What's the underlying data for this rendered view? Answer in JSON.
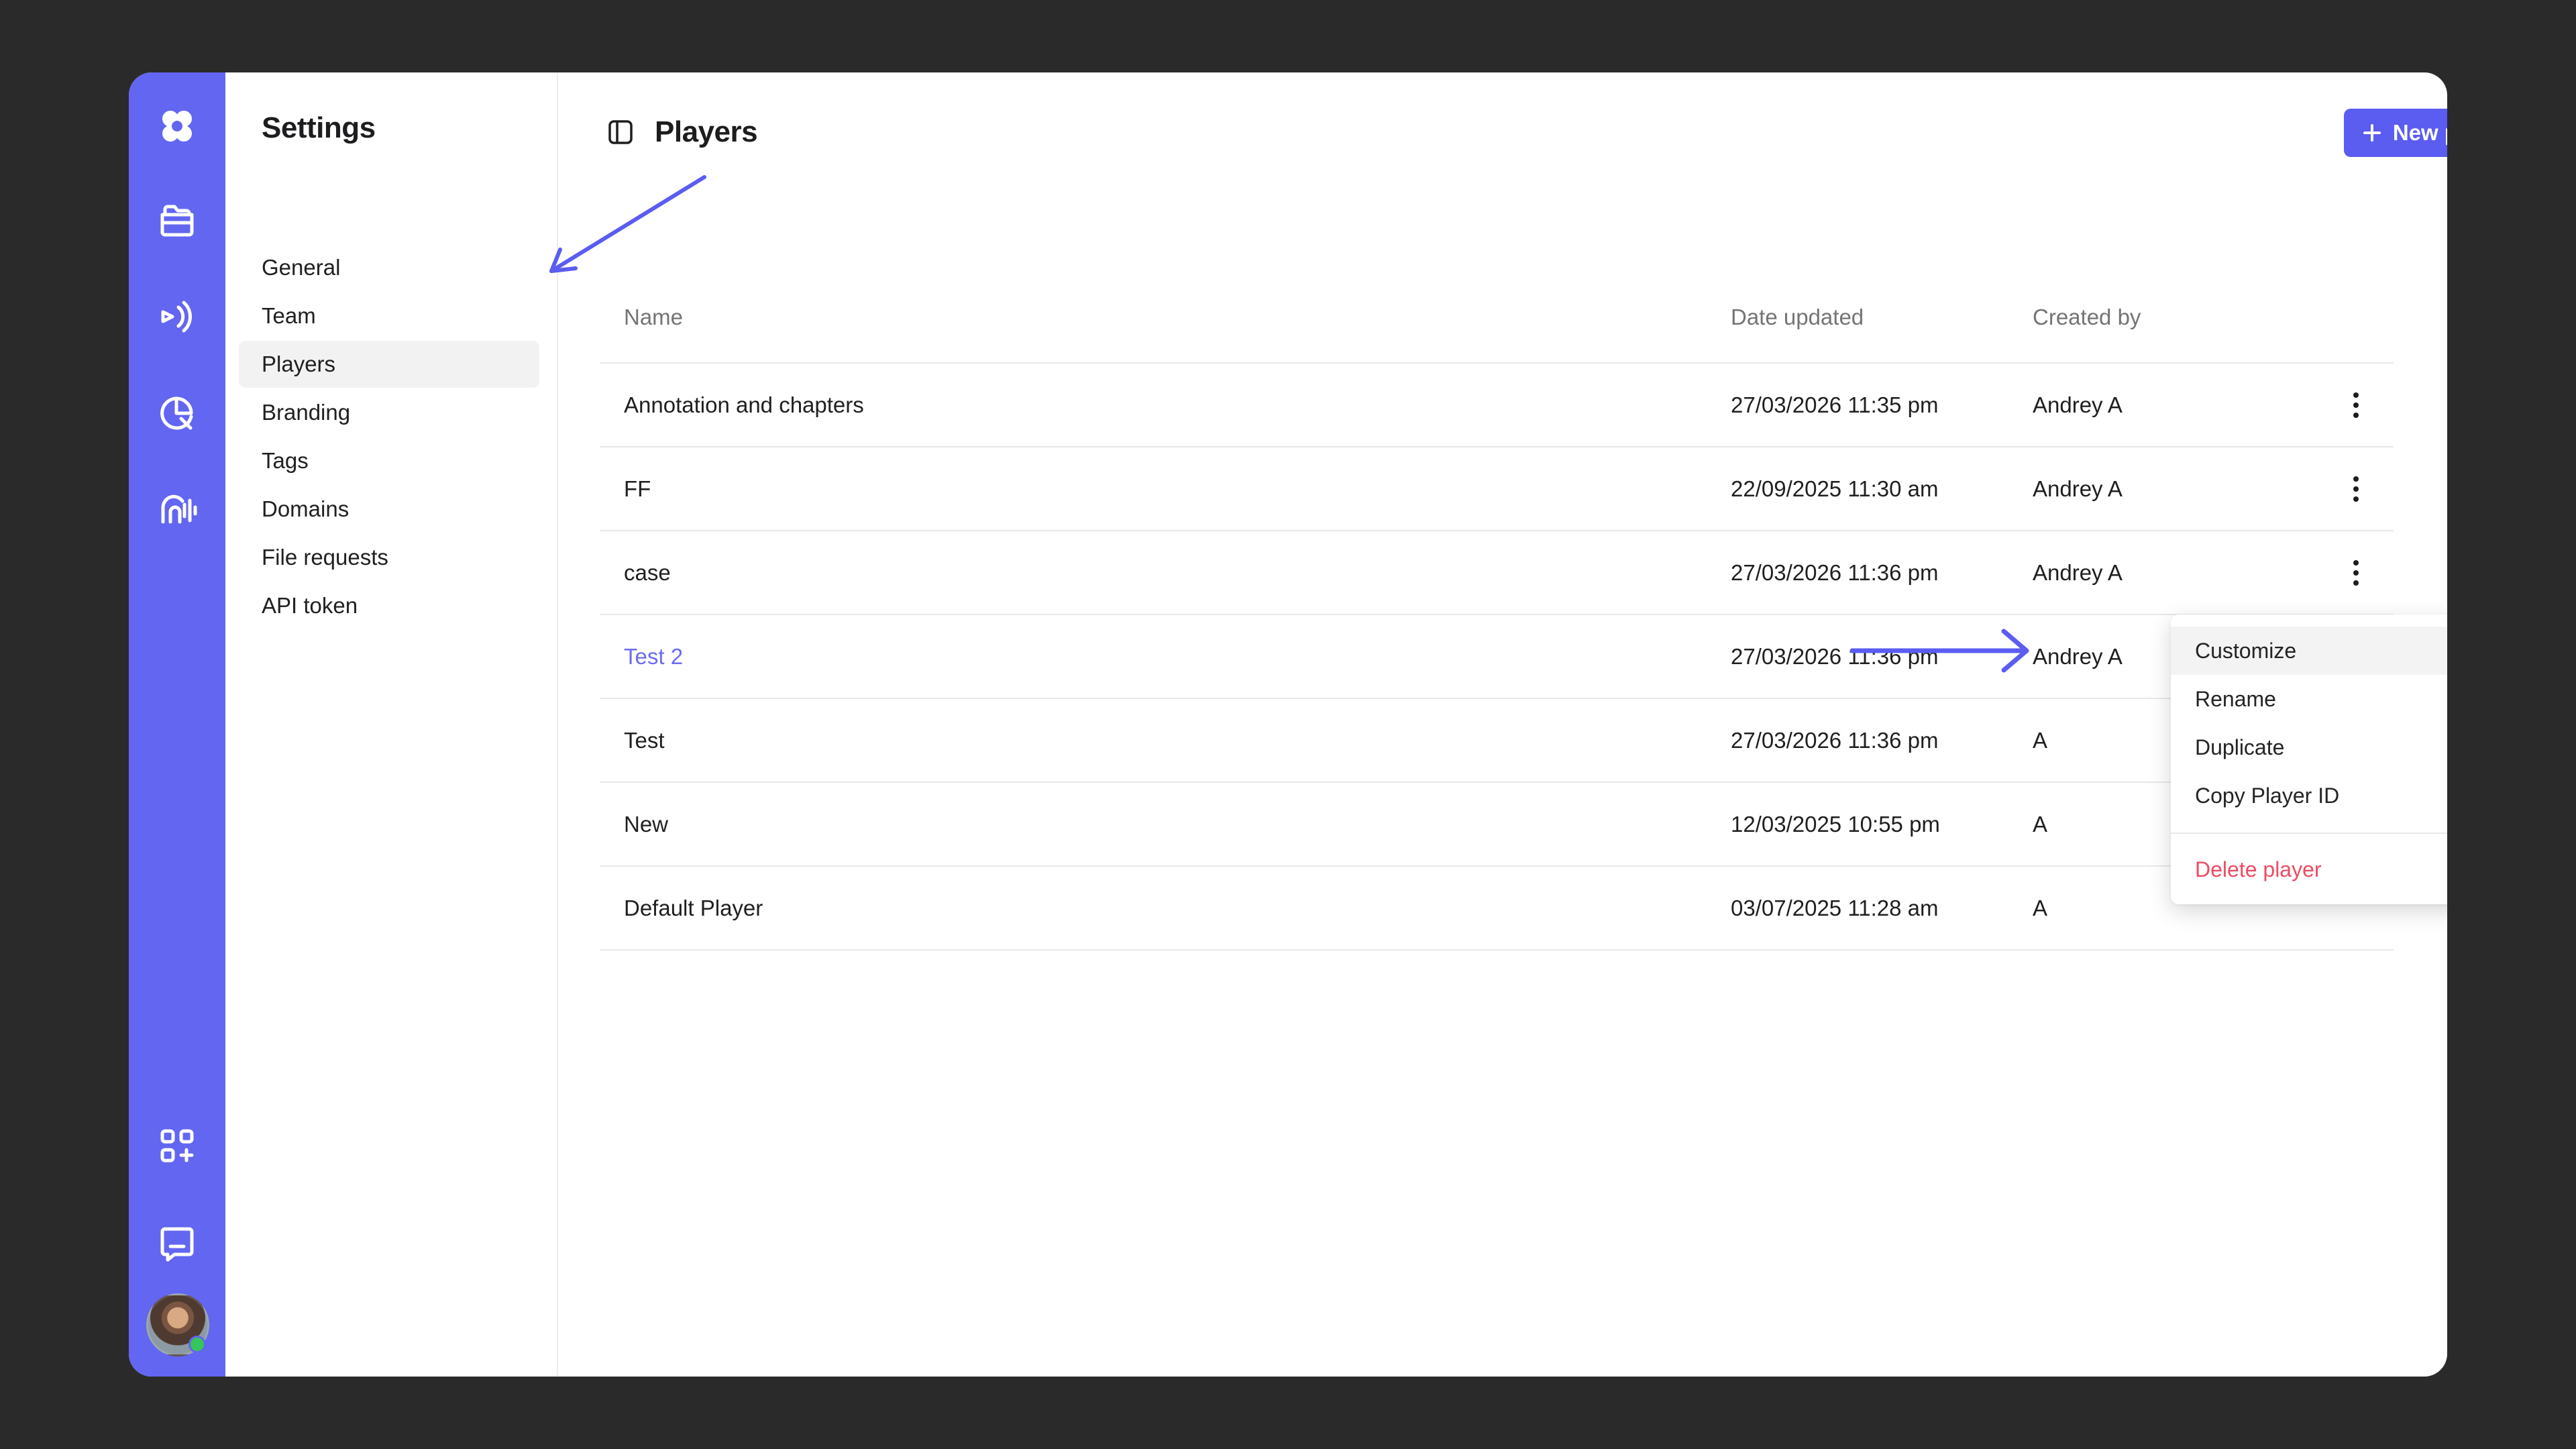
{
  "settings": {
    "title": "Settings",
    "nav": [
      {
        "label": "General"
      },
      {
        "label": "Team"
      },
      {
        "label": "Players",
        "active": true
      },
      {
        "label": "Branding"
      },
      {
        "label": "Tags"
      },
      {
        "label": "Domains"
      },
      {
        "label": "File requests"
      },
      {
        "label": "API token"
      }
    ]
  },
  "rail": {
    "icons": [
      "logo-icon",
      "folder-icon",
      "broadcast-icon",
      "analytics-icon",
      "podcast-icon",
      "apps-icon",
      "chat-icon"
    ],
    "accent_color": "#6366f1"
  },
  "header": {
    "title": "Players",
    "new_button_label": "New player"
  },
  "table": {
    "headers": [
      "Name",
      "Date updated",
      "Created by"
    ],
    "rows": [
      {
        "name": "Annotation and chapters",
        "date": "27/03/2026 11:35 pm",
        "creator": "Andrey A"
      },
      {
        "name": "FF",
        "date": "22/09/2025 11:30 am",
        "creator": "Andrey A"
      },
      {
        "name": "case",
        "date": "27/03/2026 11:36 pm",
        "creator": "Andrey A"
      },
      {
        "name": "Test 2",
        "date": "27/03/2026 11:36 pm",
        "creator": "Andrey A"
      },
      {
        "name": "Test",
        "date": "27/03/2026 11:36 pm",
        "creator": "A"
      },
      {
        "name": "New",
        "date": "12/03/2025 10:55 pm",
        "creator": "A"
      },
      {
        "name": "Default Player",
        "date": "03/07/2025 11:28 am",
        "creator": "A"
      }
    ]
  },
  "context_menu": {
    "items": [
      "Customize",
      "Rename",
      "Duplicate",
      "Copy Player ID"
    ],
    "danger_item": "Delete player"
  },
  "colors": {
    "link": "#6a6cf2",
    "button": "#5b5cf0",
    "danger": "#ef4b63",
    "background": "#2a2a2a"
  }
}
